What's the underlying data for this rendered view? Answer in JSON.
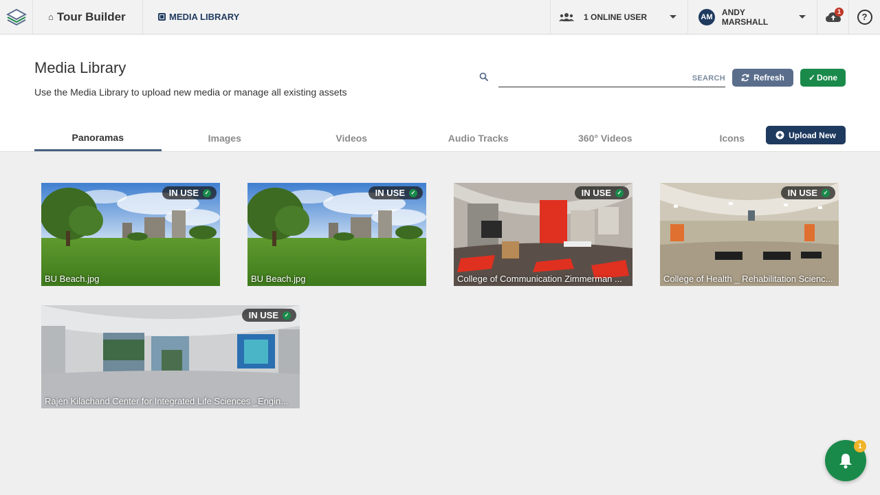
{
  "topbar": {
    "app_title": "Tour Builder",
    "breadcrumb": "MEDIA LIBRARY",
    "online_users": "1 ONLINE USER",
    "user_initials": "AM",
    "user_name": "ANDY MARSHALL",
    "cloud_badge": "1"
  },
  "header": {
    "title": "Media Library",
    "subtitle": "Use the Media Library to upload new media or manage all existing assets",
    "search_label": "SEARCH",
    "search_value": "",
    "refresh_label": "Refresh",
    "done_label": "Done",
    "upload_label": "Upload New"
  },
  "tabs": [
    {
      "label": "Panoramas",
      "active": true
    },
    {
      "label": "Images",
      "active": false
    },
    {
      "label": "Videos",
      "active": false
    },
    {
      "label": "Audio Tracks",
      "active": false
    },
    {
      "label": "360° Videos",
      "active": false
    },
    {
      "label": "Icons",
      "active": false
    }
  ],
  "media": [
    {
      "status": "IN USE",
      "caption": "BU Beach.jpg",
      "scene": "outdoor"
    },
    {
      "status": "IN USE",
      "caption": "BU Beach.jpg",
      "scene": "outdoor"
    },
    {
      "status": "IN USE",
      "caption": "College of Communication Zimmerman ...",
      "scene": "red-room"
    },
    {
      "status": "IN USE",
      "caption": "College of Health _ Rehabilitation Scienc...",
      "scene": "gym"
    },
    {
      "status": "IN USE",
      "caption": "Rajen Kilachand Center for Integrated Life Sciences _Engin...",
      "scene": "atrium"
    }
  ],
  "notifications": {
    "badge": "1"
  },
  "colors": {
    "primary": "#1f3a5f",
    "success": "#1a8a4a",
    "refresh": "#5a6e8c",
    "badge": "#f0b429"
  }
}
